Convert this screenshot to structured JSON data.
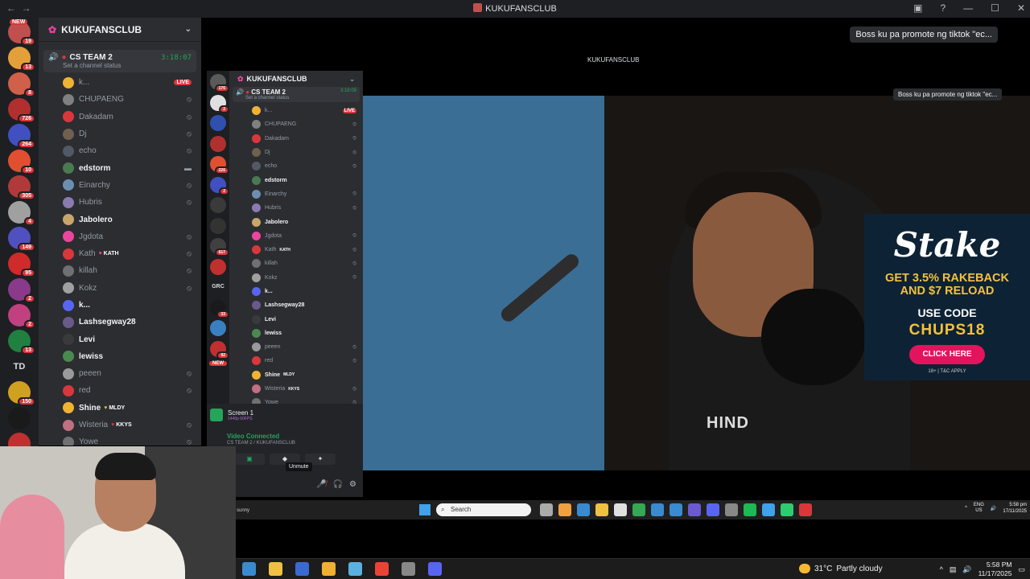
{
  "window": {
    "title": "KUKUFANSCLUB"
  },
  "guild_badges": [
    "19",
    "13",
    "8",
    "726",
    "264",
    "10",
    "305",
    "4",
    "149",
    "95",
    "2",
    "2",
    "13",
    "",
    "150",
    "",
    "2"
  ],
  "server": {
    "name": "KUKUFANSCLUB"
  },
  "voice_channel": {
    "name": "CS TEAM 2",
    "time": "3:18:07",
    "status": "Set a channel status"
  },
  "members": [
    {
      "name": "k...",
      "live": "LIVE",
      "active": false,
      "color": "#f0b232"
    },
    {
      "name": "CHUPAENG",
      "active": false,
      "color": "#808080"
    },
    {
      "name": "Dakadam",
      "active": false,
      "color": "#da373c"
    },
    {
      "name": "Dj",
      "active": false,
      "color": "#706050"
    },
    {
      "name": "echo",
      "active": false,
      "color": "#505a66"
    },
    {
      "name": "edstorm",
      "active": true,
      "color": "#4a7a50"
    },
    {
      "name": "Einarchy",
      "active": false,
      "color": "#6c8fb0"
    },
    {
      "name": "Hubris",
      "active": false,
      "color": "#8a7ab0"
    },
    {
      "name": "Jabolero",
      "active": true,
      "color": "#c8a66a"
    },
    {
      "name": "Jgdota",
      "active": false,
      "color": "#eb459e"
    },
    {
      "name": "Kath",
      "tag": "KATH",
      "active": false,
      "color": "#da373c"
    },
    {
      "name": "killah",
      "active": false,
      "color": "#707070"
    },
    {
      "name": "Kokz",
      "active": false,
      "color": "#a0a0a0"
    },
    {
      "name": "k...",
      "active": true,
      "color": "#5865f2"
    },
    {
      "name": "Lashsegway28",
      "active": true,
      "color": "#6a5a8a"
    },
    {
      "name": "Levi",
      "active": true,
      "color": "#3a3a3a"
    },
    {
      "name": "lewiss",
      "active": true,
      "color": "#4a8a50"
    },
    {
      "name": "peeen",
      "active": false,
      "color": "#9a9a9a"
    },
    {
      "name": "red",
      "active": false,
      "color": "#da373c"
    },
    {
      "name": "Shine",
      "tag": "MLDY",
      "active": true,
      "color": "#f0b232"
    },
    {
      "name": "Wisteria",
      "tag": "KKYS",
      "active": false,
      "color": "#c07080"
    },
    {
      "name": "Yowe",
      "active": false,
      "color": "#707070"
    }
  ],
  "nested": {
    "title": "KUKUFANSCLUB",
    "server_name": "KUKUFANSCLUB",
    "vc_name": "CS TEAM 2",
    "vc_time": "3:18:08",
    "vc_status": "Set a channel status",
    "screen_label": "Screen 1",
    "screen_sub": "1440p 60FPS",
    "video_connected": "Video Connected",
    "video_sub": "CS TEAM 2 / KUKUFANSCLUB",
    "tooltip": "Unmute",
    "guild_badges": [
      "176",
      "2",
      "",
      "",
      "226",
      "2",
      "",
      "",
      "617",
      "",
      "",
      "33",
      "",
      "92"
    ],
    "new_badge": "NEW",
    "grc": "GRC"
  },
  "notification": "Boss ku pa promote ng tiktok \"ec...",
  "nested_notification": "Boss ku pa promote ng tiktok \"ec...",
  "ad": {
    "logo": "Stake",
    "line1": "GET 3.5% RAKEBACK",
    "line2": "AND $7 RELOAD",
    "use_code": "USE CODE",
    "code": "CHUPS18",
    "cta": "CLICK HERE",
    "fine_print": "18+ | T&C APPLY"
  },
  "video": {
    "shirt_text": "HIND"
  },
  "inner_taskbar": {
    "search_placeholder": "Search",
    "weather_text": "sunny",
    "lang_line1": "ENG",
    "lang_line2": "US",
    "time": "5:58 pm",
    "date": "17/11/2025"
  },
  "taskbar": {
    "temperature": "31°C",
    "condition": "Partly cloudy",
    "time": "5:58 PM",
    "date": "11/17/2025"
  },
  "guild_top_new": "NEW",
  "guild_td": "TD"
}
